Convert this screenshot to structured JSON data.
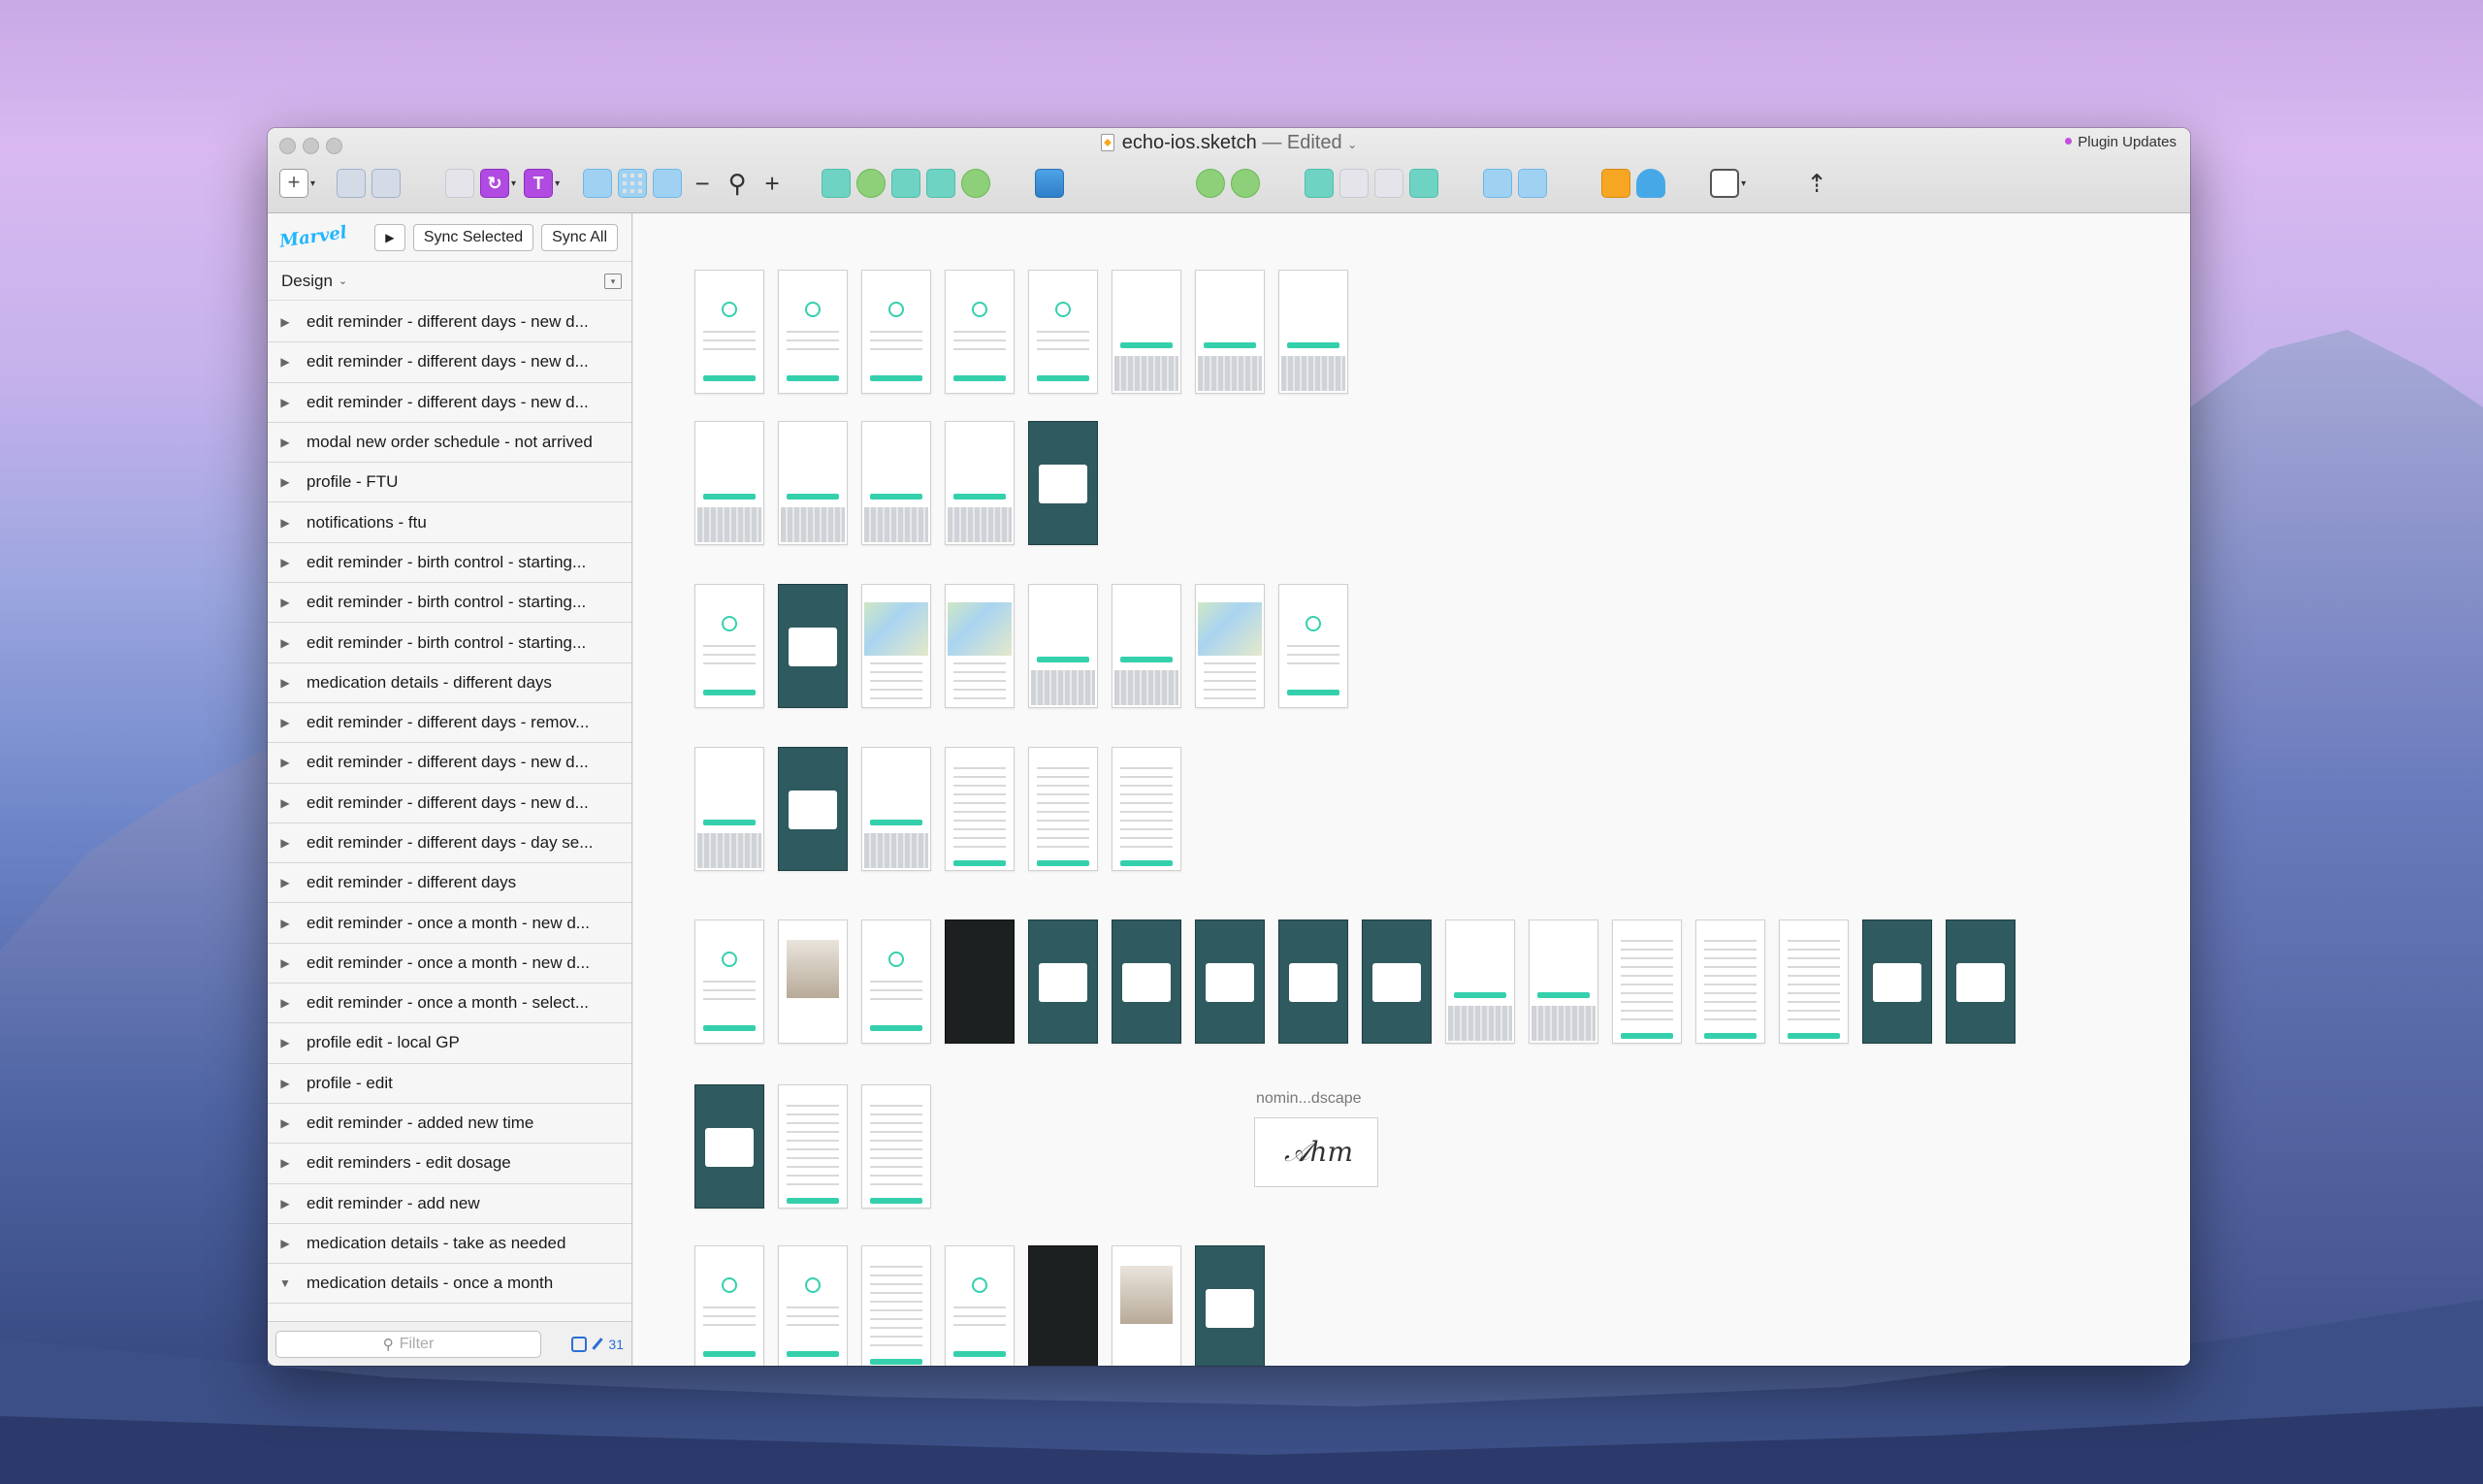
{
  "window": {
    "title": "echo-ios.sketch",
    "status": "— Edited",
    "plugin_updates": "Plugin Updates"
  },
  "sidebar": {
    "logo": "Marvel",
    "sync_selected": "Sync Selected",
    "sync_all": "Sync All",
    "page_selector": "Design",
    "filter_placeholder": "Filter",
    "artboard_count": "31",
    "pages": [
      {
        "label": "edit reminder - different days - new d...",
        "expanded": false
      },
      {
        "label": "edit reminder - different days - new d...",
        "expanded": false
      },
      {
        "label": "edit reminder - different days - new d...",
        "expanded": false
      },
      {
        "label": "modal new order schedule - not arrived",
        "expanded": false
      },
      {
        "label": "profile - FTU",
        "expanded": false
      },
      {
        "label": "notifications - ftu",
        "expanded": false
      },
      {
        "label": "edit reminder - birth control - starting...",
        "expanded": false
      },
      {
        "label": "edit reminder - birth control - starting...",
        "expanded": false
      },
      {
        "label": "edit reminder - birth control - starting...",
        "expanded": false
      },
      {
        "label": "medication details - different days",
        "expanded": false
      },
      {
        "label": "edit reminder - different days - remov...",
        "expanded": false
      },
      {
        "label": "edit reminder - different days - new d...",
        "expanded": false
      },
      {
        "label": "edit reminder - different days - new d...",
        "expanded": false
      },
      {
        "label": "edit reminder - different days - day se...",
        "expanded": false
      },
      {
        "label": "edit reminder - different days",
        "expanded": false
      },
      {
        "label": "edit reminder - once a month - new d...",
        "expanded": false
      },
      {
        "label": "edit reminder - once a month - new d...",
        "expanded": false
      },
      {
        "label": "edit reminder - once a month - select...",
        "expanded": false
      },
      {
        "label": "profile edit - local GP",
        "expanded": false
      },
      {
        "label": "profile - edit",
        "expanded": false
      },
      {
        "label": "edit reminder - added new time",
        "expanded": false
      },
      {
        "label": "edit reminders - edit dosage",
        "expanded": false
      },
      {
        "label": "edit reminder - add new",
        "expanded": false
      },
      {
        "label": "medication details - take as needed",
        "expanded": false
      },
      {
        "label": "medication details - once a month",
        "expanded": true
      }
    ]
  },
  "canvas": {
    "artboard_label": "nomin...dscape"
  },
  "colors": {
    "accent": "#34d0ac",
    "dark_board": "#2f5a5f",
    "marvel_blue": "#1fb6ff",
    "sketch_orange": "#f6a623"
  },
  "toolbar_icons": [
    "insert-icon",
    "group-icon",
    "ungroup-icon",
    "symbol-icon",
    "create-symbol-icon",
    "text-style-icon",
    "grid-icon",
    "layout-grid-icon",
    "columns-icon",
    "zoom-out-icon",
    "zoom-icon",
    "zoom-in-icon",
    "scissors-icon",
    "mask-icon",
    "scale-icon",
    "rotate-icon",
    "flatten-icon",
    "image-icon",
    "union-icon",
    "subtract-icon",
    "intersect-icon",
    "difference-icon",
    "forward-icon",
    "backward-icon",
    "sketch-cloud-icon",
    "upload-cloud-icon",
    "view-icon",
    "export-icon"
  ]
}
